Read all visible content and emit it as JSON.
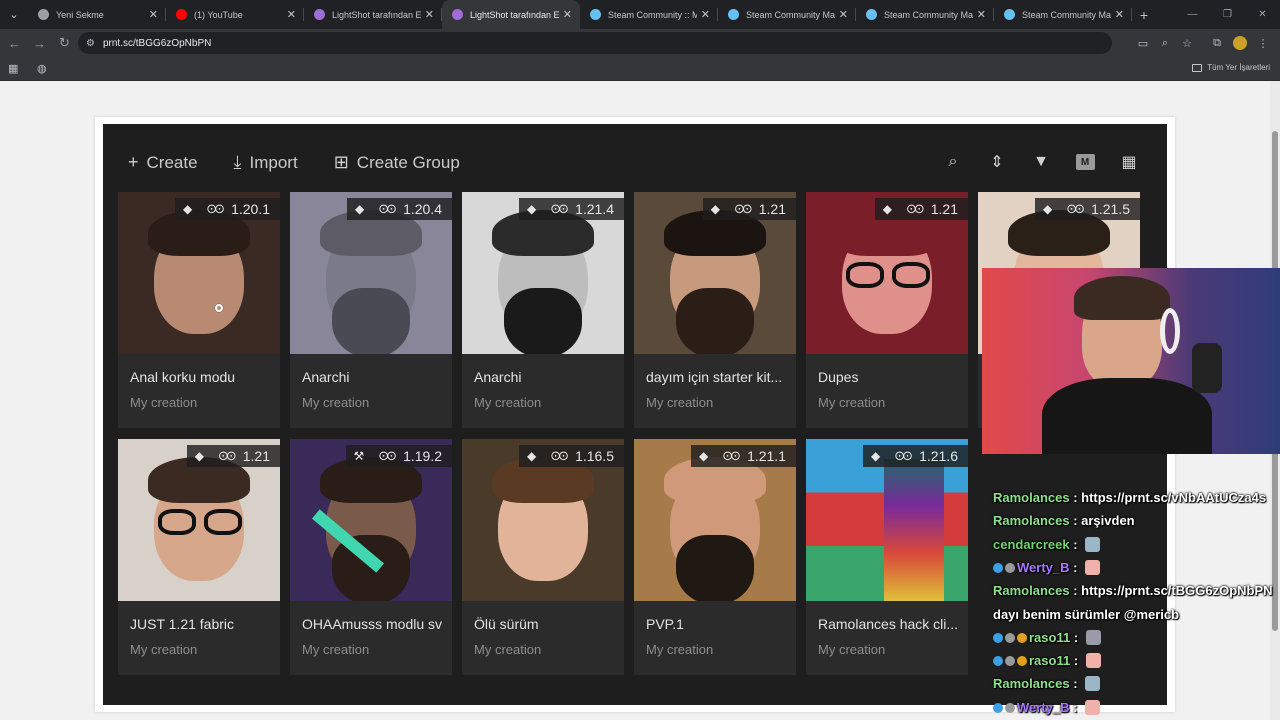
{
  "tabs": [
    {
      "title": "Yeni Sekme",
      "favicon_color": "#9aa0a6",
      "active": false
    },
    {
      "title": "(1) YouTube",
      "favicon_color": "#ff0000",
      "active": false
    },
    {
      "title": "LightShot tarafından Ekran",
      "favicon_color": "#a06cd5",
      "active": false
    },
    {
      "title": "LightShot tarafından Ekran",
      "favicon_color": "#a06cd5",
      "active": true
    },
    {
      "title": "Steam Community :: Meri",
      "favicon_color": "#66c0f4",
      "active": false
    },
    {
      "title": "Steam Community Marke",
      "favicon_color": "#66c0f4",
      "active": false
    },
    {
      "title": "Steam Community Marke",
      "favicon_color": "#66c0f4",
      "active": false
    },
    {
      "title": "Steam Community Marke",
      "favicon_color": "#66c0f4",
      "active": false
    }
  ],
  "address": {
    "url": "prnt.sc/tBGG6zOpNbPN"
  },
  "bookmarks": {
    "all_label": "Tüm Yer İşaretleri"
  },
  "launcher": {
    "actions": {
      "create": "Create",
      "import": "Import",
      "create_group": "Create Group"
    },
    "filter_badge": "M",
    "instances": [
      {
        "name": "Anal korku modu",
        "sub": "My creation",
        "version": "1.20.1",
        "tool": "hammer"
      },
      {
        "name": "Anarchi",
        "sub": "My creation",
        "version": "1.20.4",
        "tool": "hammer"
      },
      {
        "name": "Anarchi",
        "sub": "My creation",
        "version": "1.21.4",
        "tool": "hammer"
      },
      {
        "name": "dayım için starter kit...",
        "sub": "My creation",
        "version": "1.21",
        "tool": "hammer"
      },
      {
        "name": "Dupes",
        "sub": "My creation",
        "version": "1.21",
        "tool": "hammer"
      },
      {
        "name": "",
        "sub": "",
        "version": "1.21.5",
        "tool": "hammer"
      },
      {
        "name": "JUST 1.21 fabric",
        "sub": "My creation",
        "version": "1.21",
        "tool": "hammer"
      },
      {
        "name": "OHAAmusss modlu sv",
        "sub": "My creation",
        "version": "1.19.2",
        "tool": "anvil"
      },
      {
        "name": "Ölü sürüm",
        "sub": "My creation",
        "version": "1.16.5",
        "tool": "hammer"
      },
      {
        "name": "PVP.1",
        "sub": "My creation",
        "version": "1.21.1",
        "tool": "hammer"
      },
      {
        "name": "Ramolances hack cli...",
        "sub": "My creation",
        "version": "1.21.6",
        "tool": "hammer"
      }
    ]
  },
  "chat": [
    {
      "user": "Ramolances",
      "text": " : https://prnt.sc/vNbAAtUCza4s",
      "user_color": "#8de08b",
      "badges": 0,
      "emote": ""
    },
    {
      "user": "Ramolances",
      "text": " : arşivden",
      "user_color": "#8de08b",
      "badges": 0,
      "emote": ""
    },
    {
      "user": "cendarcreek",
      "text": " : ",
      "user_color": "#6fd36b",
      "badges": 0,
      "emote": "#9bb7c7"
    },
    {
      "user": "Werty_B",
      "text": " : ",
      "user_color": "#a777ff",
      "badges": 2,
      "emote": "#f0b2a8"
    },
    {
      "user": "Ramolances",
      "text": " : https://prnt.sc/tBGG6zOpNbPN",
      "user_color": "#8de08b",
      "badges": 0,
      "emote": ""
    },
    {
      "user": "",
      "text": "dayı benim sürümler @mericb",
      "user_color": "#ffffff",
      "badges": 0,
      "emote": ""
    },
    {
      "user": "raso11",
      "text": " : ",
      "user_color": "#8de08b",
      "badges": 3,
      "emote": "#9a9aa8"
    },
    {
      "user": "raso11",
      "text": " : ",
      "user_color": "#8de08b",
      "badges": 3,
      "emote": "#f0b2a8"
    },
    {
      "user": "Ramolances",
      "text": " : ",
      "user_color": "#8de08b",
      "badges": 0,
      "emote": "#9bb7c7"
    },
    {
      "user": "Werty_B",
      "text": " : ",
      "user_color": "#a777ff",
      "badges": 2,
      "emote": "#f0b2a8"
    }
  ]
}
